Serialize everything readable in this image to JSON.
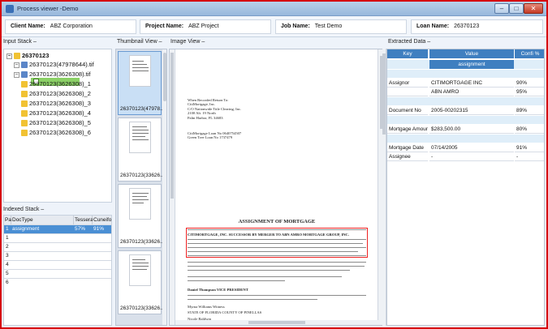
{
  "window": {
    "title": "Process viewer -Demo"
  },
  "info": {
    "client_label": "Client Name:",
    "client_value": "ABZ Corporation",
    "project_label": "Project Name:",
    "project_value": "ABZ Project",
    "job_label": "Job Name:",
    "job_value": "Test Demo",
    "loan_label": "Loan Name:",
    "loan_value": "26370123"
  },
  "panels": {
    "input_stack": "Input Stack –",
    "thumbnail_view": "Thumbnail View –",
    "image_view": "Image View –",
    "extracted_data": "Extracted Data –",
    "indexed_stack": "Indexed Stack –"
  },
  "tree": {
    "root": "26370123",
    "tif1": "26370123(47978644).tif",
    "tif2": "26370123(3626308).tif",
    "children": [
      "26370123(3626308)_1",
      "26370123(3626308)_2",
      "26370123(3626308)_3",
      "26370123(3626308)_4",
      "26370123(3626308)_5",
      "26370123(3626308)_6"
    ]
  },
  "indexed": {
    "headers": [
      "Pag",
      "DocType",
      "Tesserac",
      "Cuneiform"
    ],
    "rows": [
      {
        "page": "1",
        "doctype": "assignment",
        "tess": "57%",
        "cune": "91%"
      },
      {
        "page": "1",
        "doctype": "",
        "tess": "",
        "cune": ""
      },
      {
        "page": "2",
        "doctype": "",
        "tess": "",
        "cune": ""
      },
      {
        "page": "3",
        "doctype": "",
        "tess": "",
        "cune": ""
      },
      {
        "page": "4",
        "doctype": "",
        "tess": "",
        "cune": ""
      },
      {
        "page": "5",
        "doctype": "",
        "tess": "",
        "cune": ""
      },
      {
        "page": "6",
        "doctype": "",
        "tess": "",
        "cune": ""
      }
    ]
  },
  "thumbnails": [
    "26370123(47978...",
    "26370123(33626...",
    "26370123(33626...",
    "26370123(33626..."
  ],
  "document": {
    "return_block": [
      "When Recorded Return To:",
      "CitiMortgage, Inc.",
      "C/O Nationwide Title Clearing, Inc.",
      "2100 Alt. 19 North",
      "Palm Harbor, FL 34683"
    ],
    "loan_block": [
      "CitiMortgage Loan No 0640754507",
      "Green Tree Loan No 1737479"
    ],
    "heading": "ASSIGNMENT OF MORTGAGE",
    "snippets": [
      "CITIMORTGAGE, INC. SUCCESSOR BY MERGER TO ABN AMRO MORTGAGE GROUP, INC.",
      "Daniel Thompson   VICE PRESIDENT",
      "Myrna Williams   Witness",
      "STATE OF FLORIDA      COUNTY OF PINELLAS",
      "Nicole Baldwin"
    ]
  },
  "extracted": {
    "headers": [
      "Key",
      "Value",
      "Confi %"
    ],
    "doctype_row": "assignment",
    "rows": [
      {
        "key": "Assignor",
        "value": "CITIMORTGAGE INC",
        "conf": "90%"
      },
      {
        "key": "",
        "value": "ABN AMRO",
        "conf": "95%"
      },
      {
        "key": "Document No",
        "value": "2005-00202315",
        "conf": "89%"
      },
      {
        "key": "Mortgage Amount",
        "value": "$283,500.00",
        "conf": "80%"
      },
      {
        "key": "Mortgage Date",
        "value": "07/14/2005",
        "conf": "91%"
      },
      {
        "key": "Assignee",
        "value": "-",
        "conf": "-"
      }
    ]
  },
  "colors": {
    "accent": "#3f7fc0",
    "selected_row": "#4a8fd4",
    "tree_selected": "#8bd066",
    "frame": "#d6010a"
  }
}
